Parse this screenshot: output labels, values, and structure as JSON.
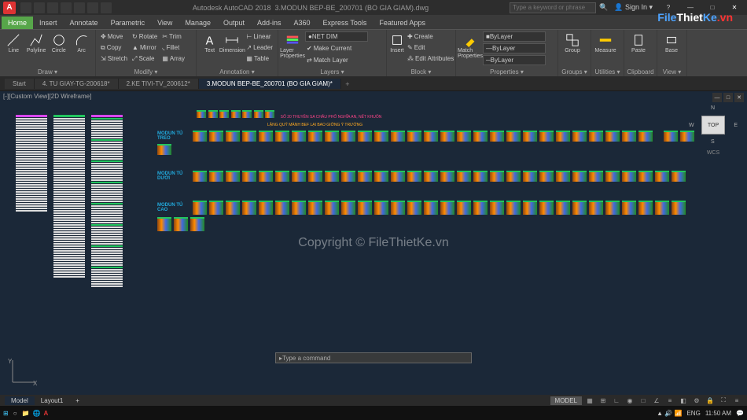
{
  "title": {
    "app": "Autodesk AutoCAD 2018",
    "file": "3.MODUN BEP-BE_200701 (BO GIA GIAM).dwg"
  },
  "search": {
    "placeholder": "Type a keyword or phrase"
  },
  "signin": "Sign In",
  "ribbonTabs": [
    "Home",
    "Insert",
    "Annotate",
    "Parametric",
    "View",
    "Manage",
    "Output",
    "Add-ins",
    "A360",
    "Express Tools",
    "Featured Apps"
  ],
  "panels": {
    "draw": {
      "title": "Draw ▾",
      "items": [
        "Line",
        "Polyline",
        "Circle",
        "Arc"
      ]
    },
    "modify": {
      "title": "Modify ▾",
      "items": [
        "Move",
        "Copy",
        "Stretch",
        "Rotate",
        "Mirror",
        "Scale",
        "Trim",
        "Fillet",
        "Array"
      ]
    },
    "annotation": {
      "title": "Annotation ▾",
      "items": [
        "Text",
        "Dimension",
        "Linear",
        "Leader",
        "Table"
      ]
    },
    "layers": {
      "title": "Layers ▾",
      "prop": "Layer Properties",
      "dropdown": "NET DIM",
      "items": [
        "Make Current",
        "Match Layer"
      ]
    },
    "block": {
      "title": "Block ▾",
      "insert": "Insert",
      "items": [
        "Create",
        "Edit",
        "Edit Attributes"
      ]
    },
    "properties": {
      "title": "Properties ▾",
      "match": "Match Properties",
      "dd1": "ByLayer",
      "dd2": "ByLayer",
      "dd3": "ByLayer"
    },
    "groups": {
      "title": "Groups ▾",
      "item": "Group"
    },
    "utilities": {
      "title": "Utilities ▾",
      "item": "Measure"
    },
    "clipboard": {
      "title": "Clipboard",
      "item": "Paste"
    },
    "view": {
      "title": "View ▾",
      "item": "Base"
    }
  },
  "fileTabs": [
    "Start",
    "4. TU GIAY-TG-200618*",
    "2.KE TIVI-TV_200612*",
    "3.MODUN BEP-BE_200701 (BO GIA GIAM)*"
  ],
  "viewport": {
    "label": "[-][Custom View][2D Wireframe]",
    "cubeface": "TOP",
    "wcs": "WCS",
    "dirs": {
      "n": "N",
      "s": "S",
      "e": "E",
      "w": "W"
    }
  },
  "rowLabels": [
    "MODUN TỦ TREO",
    "MODUN TỦ DƯỚI",
    "MODUN TỦ CAO"
  ],
  "annotations": {
    "red": "SỐ 20 THUYỀN SA CHÂU PHỐ NGHĨA AN, NẾT KHUÔN",
    "orange": "LẶNG QUỶ MÀNH BEF LẠI BAO GIỜNG Ý TRƯỚNG"
  },
  "ucs": {
    "x": "X",
    "y": "Y"
  },
  "cmdline": "Type a command",
  "watermark": "Copyright © FileThietKe.vn",
  "logo": {
    "p1": "File",
    "p2": "Thiet",
    "p3": "Ke",
    "p4": ".vn"
  },
  "modelTabs": [
    "Model",
    "Layout1"
  ],
  "status": {
    "model": "MODEL",
    "lang": "ENG",
    "time": "11:50 AM"
  }
}
